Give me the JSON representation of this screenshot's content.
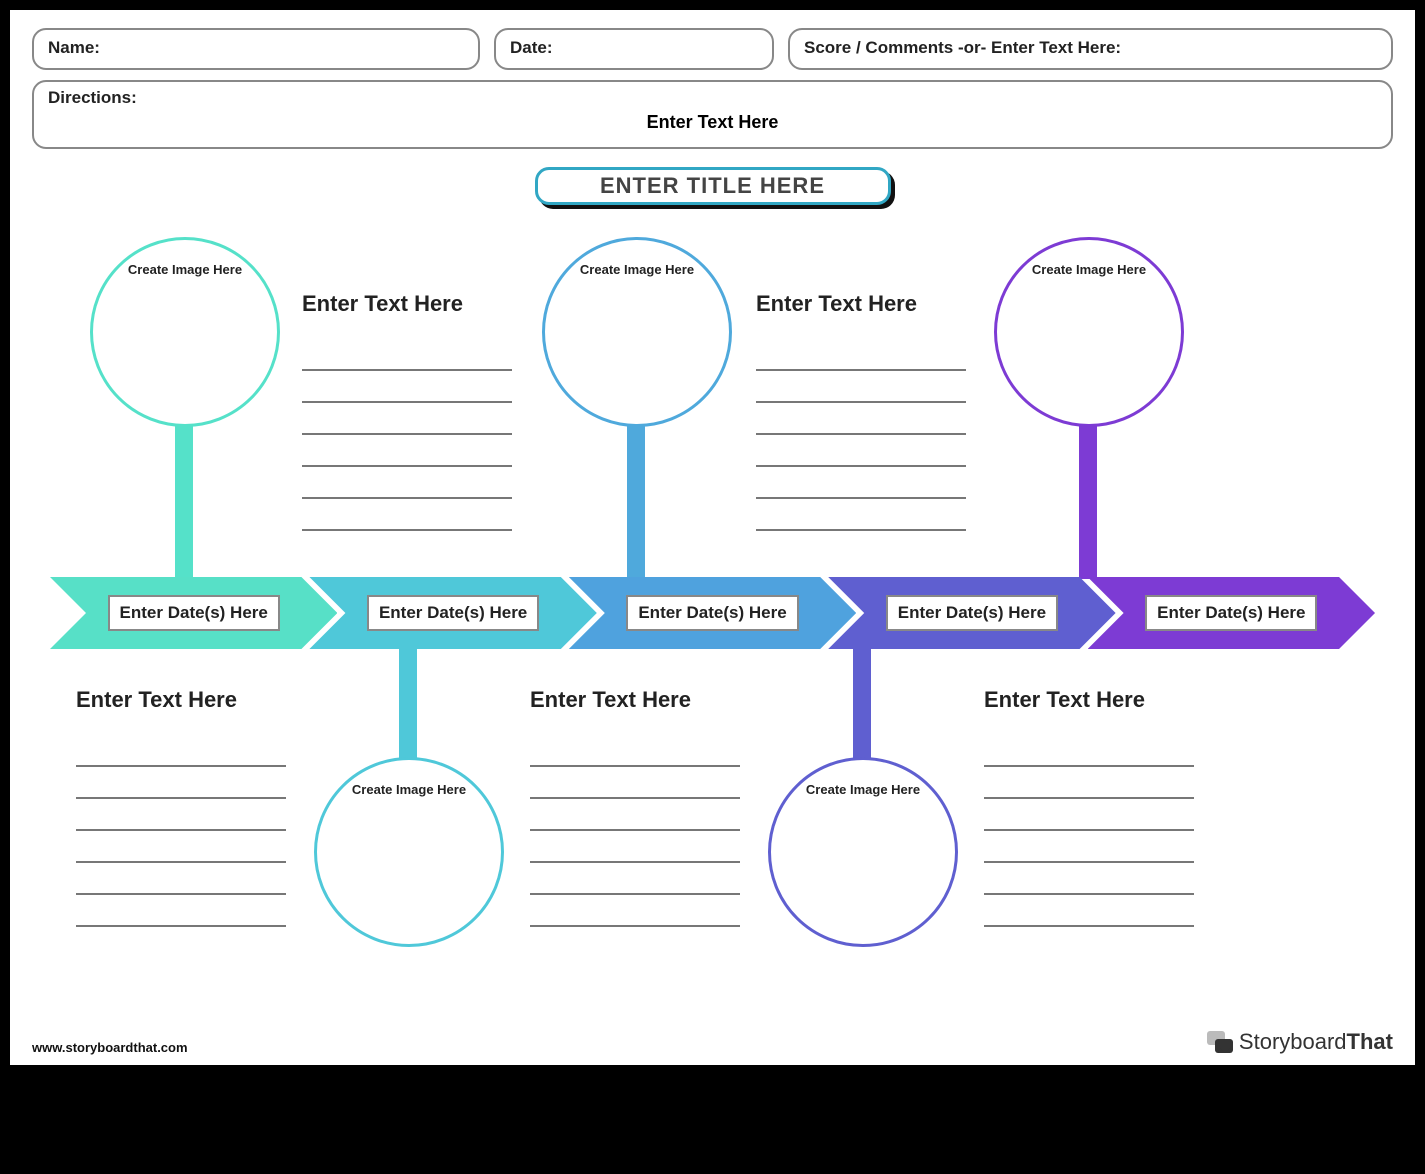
{
  "header": {
    "name_label": "Name:",
    "date_label": "Date:",
    "score_label": "Score / Comments -or- Enter Text Here:"
  },
  "directions": {
    "label": "Directions:",
    "text": "Enter Text Here"
  },
  "title": "ENTER TITLE HERE",
  "timeline": {
    "arrows": [
      {
        "color": "#57e0c7",
        "date": "Enter Date(s) Here"
      },
      {
        "color": "#4fc8d9",
        "date": "Enter Date(s) Here"
      },
      {
        "color": "#4fa2de",
        "date": "Enter Date(s) Here"
      },
      {
        "color": "#5f5fd0",
        "date": "Enter Date(s) Here"
      },
      {
        "color": "#7d3bd4",
        "date": "Enter Date(s) Here"
      }
    ]
  },
  "circles": {
    "top": [
      {
        "placeholder": "Create Image Here"
      },
      {
        "placeholder": "Create Image Here"
      },
      {
        "placeholder": "Create Image Here"
      }
    ],
    "bottom": [
      {
        "placeholder": "Create Image Here"
      },
      {
        "placeholder": "Create Image Here"
      }
    ]
  },
  "textblocks": {
    "top": [
      {
        "label": "Enter Text Here"
      },
      {
        "label": "Enter Text Here"
      }
    ],
    "bottom": [
      {
        "label": "Enter Text Here"
      },
      {
        "label": "Enter Text Here"
      },
      {
        "label": "Enter Text Here"
      }
    ]
  },
  "footer": {
    "url": "www.storyboardthat.com",
    "brand_a": "Storyboard",
    "brand_b": "That"
  }
}
